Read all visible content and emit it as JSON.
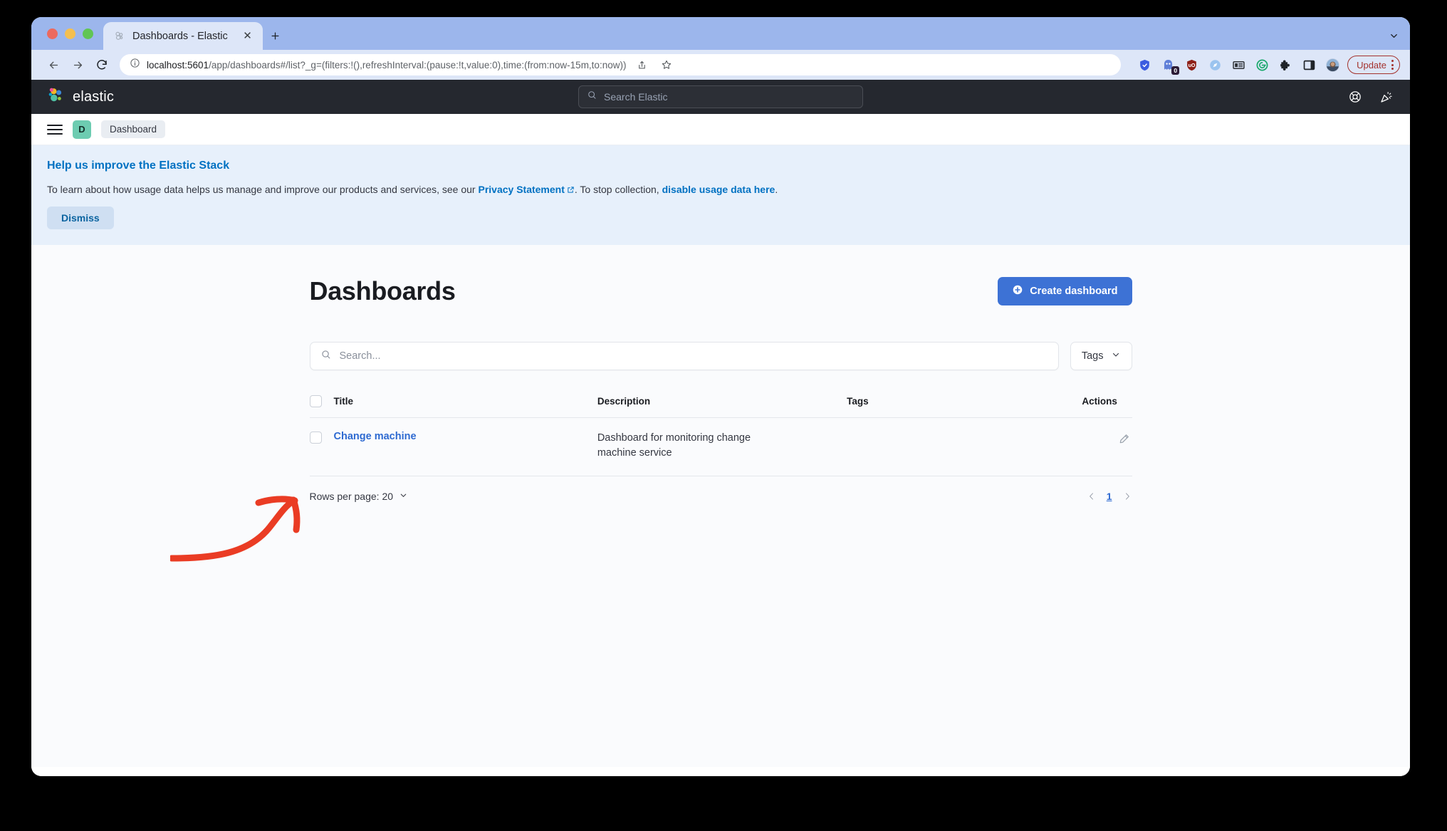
{
  "browser": {
    "tab": {
      "title": "Dashboards - Elastic",
      "favicon_icon": "elastic-logo-icon",
      "close_icon": "close-icon"
    },
    "new_tab_icon": "plus-icon",
    "window_chevron_icon": "chevron-down-icon",
    "traffic_lights": [
      "close-window-button",
      "minimize-window-button",
      "maximize-window-button"
    ],
    "nav": {
      "back_icon": "arrow-left-icon",
      "forward_icon": "arrow-right-icon",
      "reload_icon": "reload-icon"
    },
    "omnibox": {
      "site_info_icon": "info-circle-icon",
      "url_host": "localhost:5601",
      "url_path": "/app/dashboards#/list?_g=(filters:!(),refreshInterval:(pause:!t,value:0),time:(from:now-15m,to:now))",
      "share_icon": "share-icon",
      "bookmark_icon": "star-icon"
    },
    "extensions": [
      {
        "name": "shield-extension-icon",
        "color": "#3b5ce0",
        "badge": ""
      },
      {
        "name": "ghostery-extension-icon",
        "color": "#5f7fd8",
        "badge": "0"
      },
      {
        "name": "ublock-extension-icon",
        "color": "#8d1f17",
        "badge": ""
      },
      {
        "name": "compass-extension-icon",
        "color": "#7fb3e8",
        "badge": ""
      },
      {
        "name": "reader-extension-icon",
        "color": "#2f3338",
        "badge": ""
      },
      {
        "name": "grammarly-extension-icon",
        "color": "#1aa96c",
        "badge": ""
      },
      {
        "name": "puzzle-extensions-icon",
        "color": "#1f2328",
        "badge": ""
      },
      {
        "name": "sidepanel-icon",
        "color": "#1f2328",
        "badge": ""
      },
      {
        "name": "profile-avatar",
        "color": "#6b8fc4",
        "badge": ""
      }
    ],
    "update_button": "Update",
    "menu_icon": "kebab-menu-icon"
  },
  "elastic_header": {
    "logo_icon": "elastic-logo-icon",
    "wordmark": "elastic",
    "search": {
      "icon": "search-icon",
      "placeholder": "Search Elastic",
      "value": ""
    },
    "help_icon": "help-lifebuoy-icon",
    "news_icon": "news-celebration-icon"
  },
  "breadcrumb": {
    "nav_toggle_icon": "hamburger-menu-icon",
    "space_initial": "D",
    "space_color": "#6dccb1",
    "items": [
      "Dashboard"
    ]
  },
  "usage_banner": {
    "title": "Help us improve the Elastic Stack",
    "body_before_link": "To learn about how usage data helps us manage and improve our products and services, see our ",
    "privacy_link": "Privacy Statement",
    "external_link_icon": "external-link-icon",
    "body_middle": ". To stop collection, ",
    "disable_link": "disable usage data here",
    "body_end": ".",
    "dismiss_label": "Dismiss"
  },
  "main": {
    "page_title": "Dashboards",
    "create_button": {
      "icon": "plus-circle-icon",
      "label": "Create dashboard"
    },
    "search": {
      "icon": "search-icon",
      "placeholder": "Search...",
      "value": ""
    },
    "tags_filter": {
      "label": "Tags",
      "chevron_icon": "chevron-down-icon"
    },
    "table": {
      "select_all_checkbox": "select-all-checkbox",
      "columns": [
        "Title",
        "Description",
        "Tags",
        "Actions"
      ],
      "rows": [
        {
          "checkbox": "row-checkbox",
          "title": "Change machine",
          "description": "Dashboard for monitoring change machine service",
          "tags": "",
          "action_icon": "pencil-edit-icon"
        }
      ]
    },
    "pagination": {
      "rows_per_page_label": "Rows per page: 20",
      "rows_per_page_chevron": "chevron-down-icon",
      "prev_icon": "chevron-left-icon",
      "next_icon": "chevron-right-icon",
      "current_page": "1"
    }
  },
  "annotation": {
    "type": "hand-drawn-arrow",
    "color": "#ea3c24",
    "points_to": "change-machine-row"
  },
  "colors": {
    "accent_blue": "#3d72d5",
    "link_blue": "#2e6ad1",
    "banner_blue": "#0071c2",
    "header_dark": "#25282f",
    "annotation_red": "#ea3c24",
    "space_teal": "#6dccb1"
  }
}
